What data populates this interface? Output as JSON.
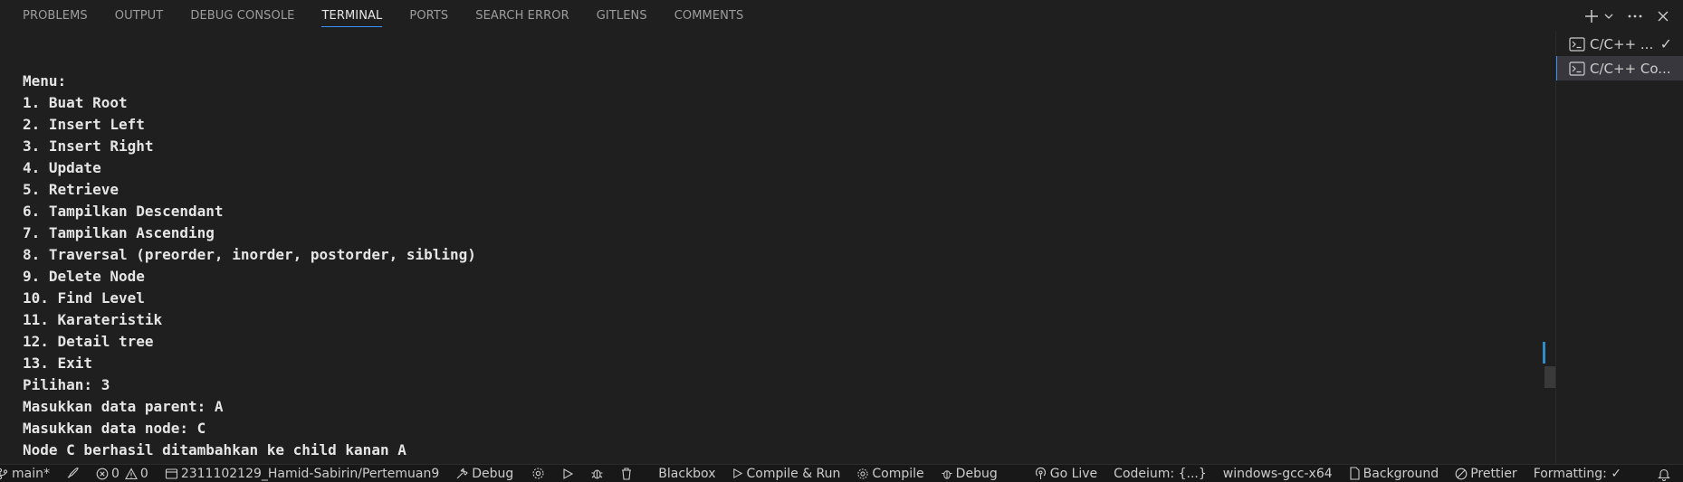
{
  "panel": {
    "tabs": [
      {
        "label": "PROBLEMS"
      },
      {
        "label": "OUTPUT"
      },
      {
        "label": "DEBUG CONSOLE"
      },
      {
        "label": "TERMINAL"
      },
      {
        "label": "PORTS"
      },
      {
        "label": "SEARCH ERROR"
      },
      {
        "label": "GITLENS"
      },
      {
        "label": "COMMENTS"
      }
    ],
    "active_tab": "TERMINAL",
    "actions": {
      "new_terminal_icon": "plus-icon",
      "dropdown_icon": "chevron-down-icon",
      "more_icon": "ellipsis-icon",
      "close_icon": "close-icon"
    }
  },
  "terminal": {
    "lines": [
      "Menu:",
      "1. Buat Root",
      "2. Insert Left",
      "3. Insert Right",
      "4. Update",
      "5. Retrieve",
      "6. Tampilkan Descendant",
      "7. Tampilkan Ascending",
      "8. Traversal (preorder, inorder, postorder, sibling)",
      "9. Delete Node",
      "10. Find Level",
      "11. Karateristik",
      "12. Detail tree",
      "13. Exit",
      "Pilihan: 3",
      "Masukkan data parent: A",
      "Masukkan data node: C",
      "Node C berhasil ditambahkan ke child kanan A"
    ]
  },
  "terminal_list": {
    "items": [
      {
        "label": "C/C++ ...",
        "icon": "terminal-icon",
        "status": "✓"
      },
      {
        "label": "C/C++ Co...",
        "icon": "terminal-icon"
      }
    ]
  },
  "statusbar": {
    "branch": "main*",
    "rocket": "rocket-icon",
    "errors": "0",
    "warnings": "0",
    "repo": "2311102129_Hamid-Sabirin/Pertemuan9",
    "debug1": "Debug",
    "blackbox": "Blackbox",
    "compile_run": "Compile & Run",
    "compile": "Compile",
    "debug2": "Debug",
    "go_live": "Go Live",
    "codeium": "Codeium: {...}",
    "compiler": "windows-gcc-x64",
    "background": "Background",
    "prettier": "Prettier",
    "formatting": "Formatting: ✓"
  },
  "colors": {
    "background": "#1f1f1f",
    "accent": "#3794ff",
    "terminal_text": "#e5e5e5"
  }
}
